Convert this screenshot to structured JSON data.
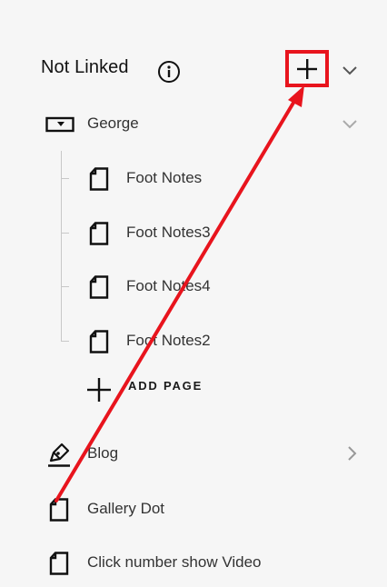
{
  "header": {
    "title": "Not Linked",
    "info_icon": "info-circle-icon",
    "add_icon": "plus-icon",
    "collapse_icon": "chevron-down-icon"
  },
  "folder": {
    "label": "George",
    "icon": "folder-icon",
    "chevron_icon": "chevron-down-icon",
    "pages": [
      {
        "label": "Foot Notes",
        "icon": "page-icon"
      },
      {
        "label": "Foot Notes3",
        "icon": "page-icon"
      },
      {
        "label": "Foot Notes4",
        "icon": "page-icon"
      },
      {
        "label": "Foot Notes2",
        "icon": "page-icon"
      }
    ],
    "add_page_label": "ADD PAGE"
  },
  "items": [
    {
      "label": "Blog",
      "icon": "blog-pen-icon",
      "chevron_icon": "chevron-right-icon"
    },
    {
      "label": "Gallery Dot",
      "icon": "page-icon"
    },
    {
      "label": "Click number show Video",
      "icon": "page-icon"
    }
  ],
  "annotation": {
    "highlight_color": "#e8141d"
  }
}
